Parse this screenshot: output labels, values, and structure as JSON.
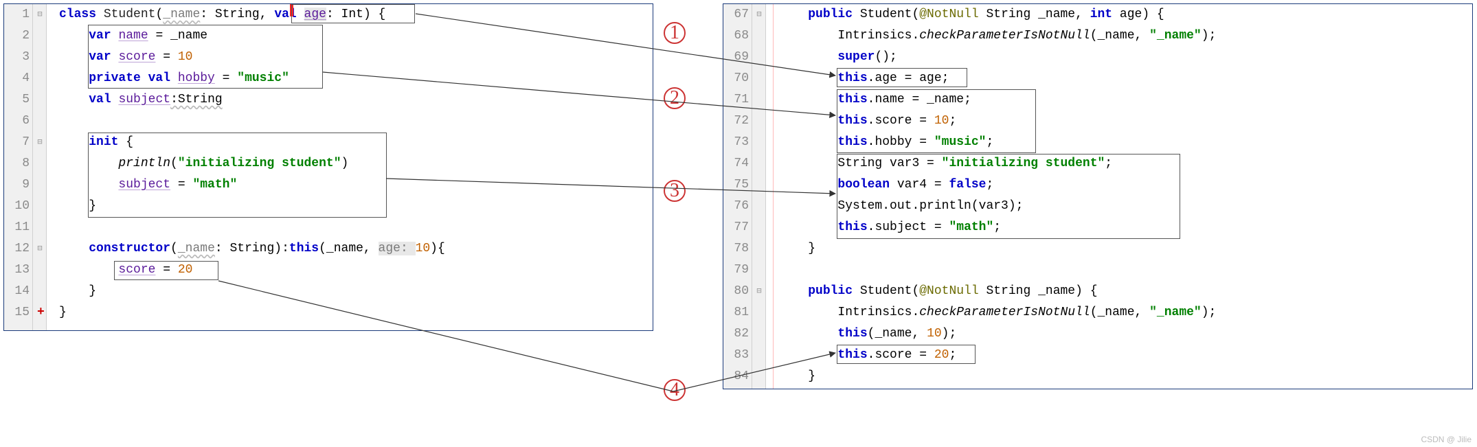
{
  "left": {
    "lines": [
      "1",
      "2",
      "3",
      "4",
      "5",
      "6",
      "7",
      "8",
      "9",
      "10",
      "11",
      "12",
      "13",
      "14",
      "15"
    ],
    "mod_marker": "+",
    "code": {
      "l1": {
        "kw_class": "class",
        "name": "Student",
        "p_open": "(",
        "p1u": "_name",
        "c1": ": String, ",
        "kw_val": "val ",
        "age": "age",
        "c2": ": Int) {"
      },
      "l2": {
        "kw": "var ",
        "name": "name",
        "rest": " = _name"
      },
      "l3": {
        "kw": "var ",
        "score": "score",
        "eq": " = ",
        "num": "10"
      },
      "l4": {
        "kw": "private val ",
        "hobby": "hobby",
        "eq": " = ",
        "str": "\"music\""
      },
      "l5": {
        "kw": "val ",
        "subj": "subject",
        "rest": ":String"
      },
      "l7": {
        "kw": "init",
        "br": " {"
      },
      "l8": {
        "fn": "println",
        "p": "(",
        "str": "\"initializing student\"",
        "cp": ")"
      },
      "l9": {
        "subj": "subject",
        "eq": " = ",
        "str": "\"math\""
      },
      "l10": {
        "br": "}"
      },
      "l12": {
        "kw": "constructor",
        "p": "(",
        "pname": "_name",
        "c": ": String):",
        "kw_this": "this",
        "p2": "(_name, ",
        "agehint": "age: ",
        "num": "10",
        "cp": "){"
      },
      "l13": {
        "score": "score",
        "eq": " = ",
        "num": "20"
      },
      "l14": {
        "br": "}"
      },
      "l15": {
        "br": "}"
      }
    }
  },
  "right": {
    "lines": [
      "67",
      "68",
      "69",
      "70",
      "71",
      "72",
      "73",
      "74",
      "75",
      "76",
      "77",
      "78",
      "79",
      "80",
      "81",
      "82",
      "83",
      "84"
    ],
    "code": {
      "l67": {
        "kw": "public",
        "sp": " Student(",
        "ann": "@NotNull",
        "rest1": " String _name, ",
        "kw_int": "int",
        "rest2": " age) {"
      },
      "l68": {
        "txt": "Intrinsics.",
        "fn": "checkParameterIsNotNull",
        "args": "(_name, ",
        "str": "\"_name\"",
        "cp": ");"
      },
      "l69": {
        "kw": "super",
        "rest": "();"
      },
      "l70": {
        "kw_this": "this",
        "dot": ".age = age;"
      },
      "l71": {
        "kw_this": "this",
        "dot": ".name = _name;"
      },
      "l72": {
        "kw_this": "this",
        "dot": ".score = ",
        "num": "10",
        "sc": ";"
      },
      "l73": {
        "kw_this": "this",
        "dot": ".hobby = ",
        "str": "\"music\"",
        "sc": ";"
      },
      "l74": {
        "txt": "String var3 = ",
        "str": "\"initializing student\"",
        "sc": ";"
      },
      "l75": {
        "kw": "boolean",
        "rest": " var4 = ",
        "kw_false": "false",
        "sc": ";"
      },
      "l76": {
        "txt": "System.out.println(var3);"
      },
      "l77": {
        "kw_this": "this",
        "dot": ".subject = ",
        "str": "\"math\"",
        "sc": ";"
      },
      "l78": {
        "br": "}"
      },
      "l80": {
        "kw": "public",
        "rest": " Student(",
        "ann": "@NotNull",
        "rest2": " String _name) {"
      },
      "l81": {
        "txt": "Intrinsics.",
        "fn": "checkParameterIsNotNull",
        "args": "(_name, ",
        "str": "\"_name\"",
        "cp": ");"
      },
      "l82": {
        "kw_this": "this",
        "rest": "(_name, ",
        "num": "10",
        "cp": ");"
      },
      "l83": {
        "kw_this": "this",
        "dot": ".score = ",
        "num": "20",
        "sc": ";"
      },
      "l84": {
        "br": "}"
      }
    }
  },
  "callouts": {
    "c1": "1",
    "c2": "2",
    "c3": "3",
    "c4": "4"
  },
  "watermark": "CSDN @ Jilie"
}
